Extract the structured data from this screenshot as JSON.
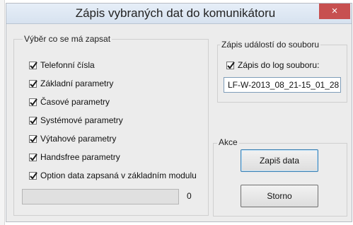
{
  "window": {
    "title": "Zápis vybraných dat do komunikátoru",
    "close_label": "×"
  },
  "select_group": {
    "legend": "Výběr co se má zapsat",
    "items": [
      {
        "label": "Telefonní čísla",
        "checked": true
      },
      {
        "label": "Základní parametry",
        "checked": true
      },
      {
        "label": "Časové parametry",
        "checked": true
      },
      {
        "label": "Systémové parametry",
        "checked": true
      },
      {
        "label": "Výtahové parametry",
        "checked": true
      },
      {
        "label": "Handsfree parametry",
        "checked": true
      },
      {
        "label": "Option data zapsaná v základním modulu",
        "checked": true
      }
    ],
    "progress_value": "0"
  },
  "log_group": {
    "legend": "Zápis událostí do souboru",
    "checkbox_label": "Zápis do log souboru:",
    "checkbox_checked": true,
    "filename": "LF-W-2013_08_21-15_01_28"
  },
  "actions_group": {
    "legend": "Akce",
    "write_button": "Zapiš data",
    "cancel_button": "Storno"
  }
}
